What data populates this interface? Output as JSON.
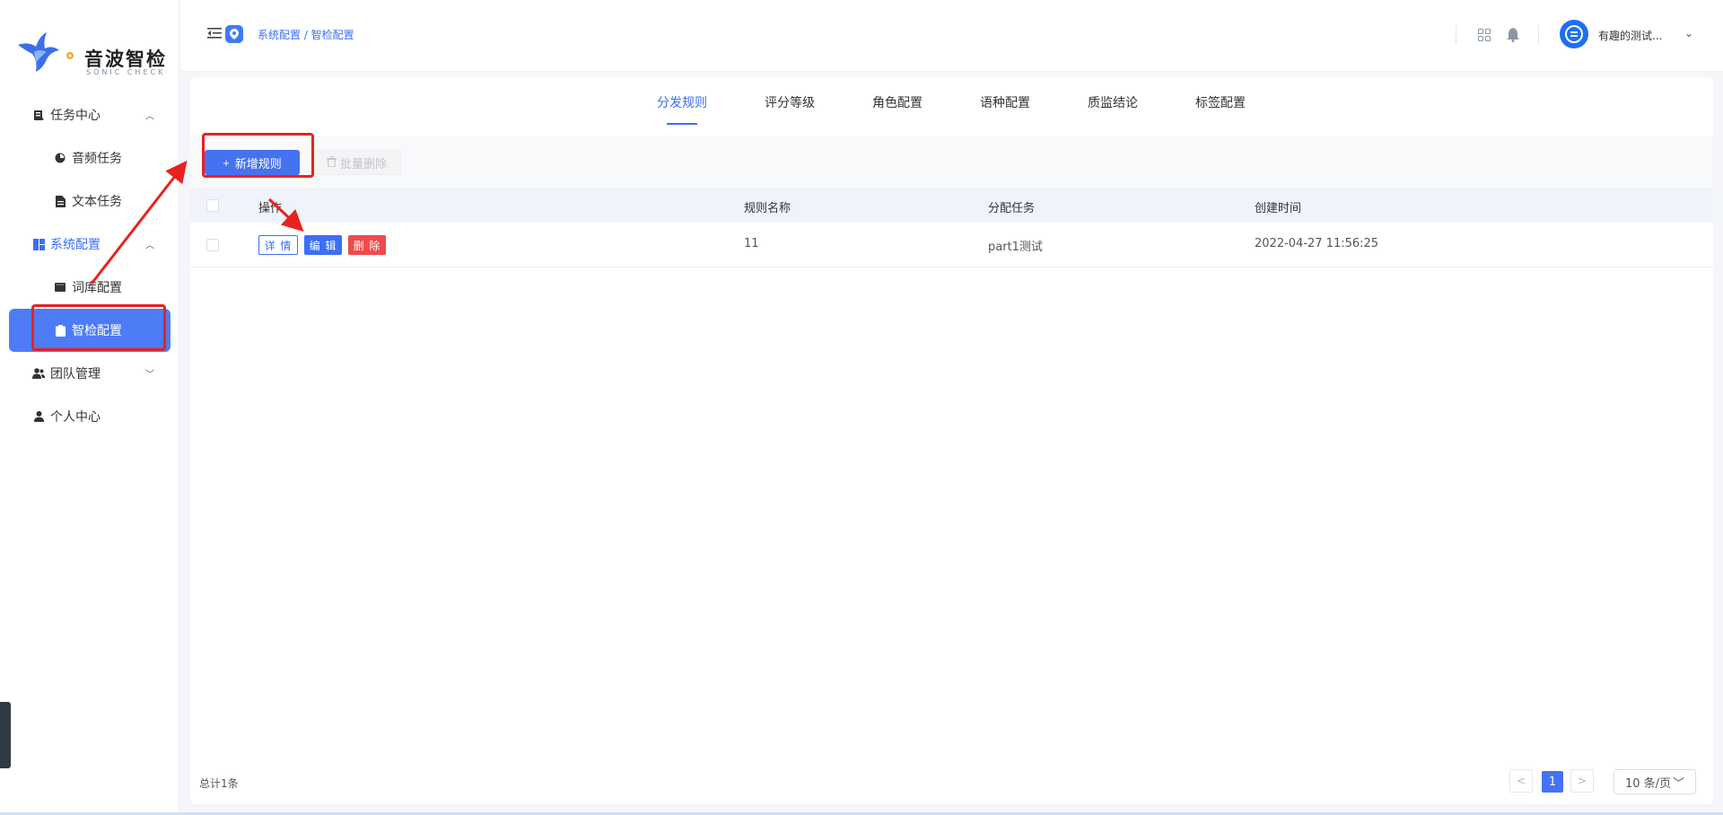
{
  "app": {
    "logo_text": "音波智检",
    "logo_sub": "SONIC CHECK"
  },
  "sidebar": {
    "items": [
      {
        "label": "任务中心",
        "icon": "task-doc-icon",
        "level": 1,
        "expanded": true
      },
      {
        "label": "音频任务",
        "icon": "pie-clock-icon",
        "level": 2
      },
      {
        "label": "文本任务",
        "icon": "doc-icon",
        "level": 2
      },
      {
        "label": "系统配置",
        "icon": "dashboard-icon",
        "level": 1,
        "expanded": true
      },
      {
        "label": "词库配置",
        "icon": "book-icon",
        "level": 2
      },
      {
        "label": "智检配置",
        "icon": "clipboard-icon",
        "level": 2,
        "active": true
      },
      {
        "label": "团队管理",
        "icon": "team-icon",
        "level": 1,
        "expanded": false
      },
      {
        "label": "个人中心",
        "icon": "user-icon",
        "level": 1
      }
    ]
  },
  "header": {
    "breadcrumb": "系统配置 / 智检配置",
    "username": "有趣的测试...",
    "chevron": "⌄"
  },
  "tabs": [
    {
      "label": "分发规则",
      "active": true
    },
    {
      "label": "评分等级"
    },
    {
      "label": "角色配置"
    },
    {
      "label": "语种配置"
    },
    {
      "label": "质监结论"
    },
    {
      "label": "标签配置"
    }
  ],
  "toolbar": {
    "add_label": "新增规则",
    "batch_delete_label": "批量删除"
  },
  "table": {
    "columns": [
      "操作",
      "规则名称",
      "分配任务",
      "创建时间"
    ],
    "rows": [
      {
        "actions": [
          "详 情",
          "编 辑",
          "删 除"
        ],
        "name": "11",
        "task": "part1测试",
        "created": "2022-04-27 11:56:25"
      }
    ]
  },
  "footer": {
    "total": "总计1条",
    "current_page": "1",
    "page_size": "10 条/页",
    "prev": "<",
    "next": ">"
  },
  "colors": {
    "primary": "#4472f3",
    "danger": "#f04a4a",
    "annotation": "#e8221f"
  }
}
